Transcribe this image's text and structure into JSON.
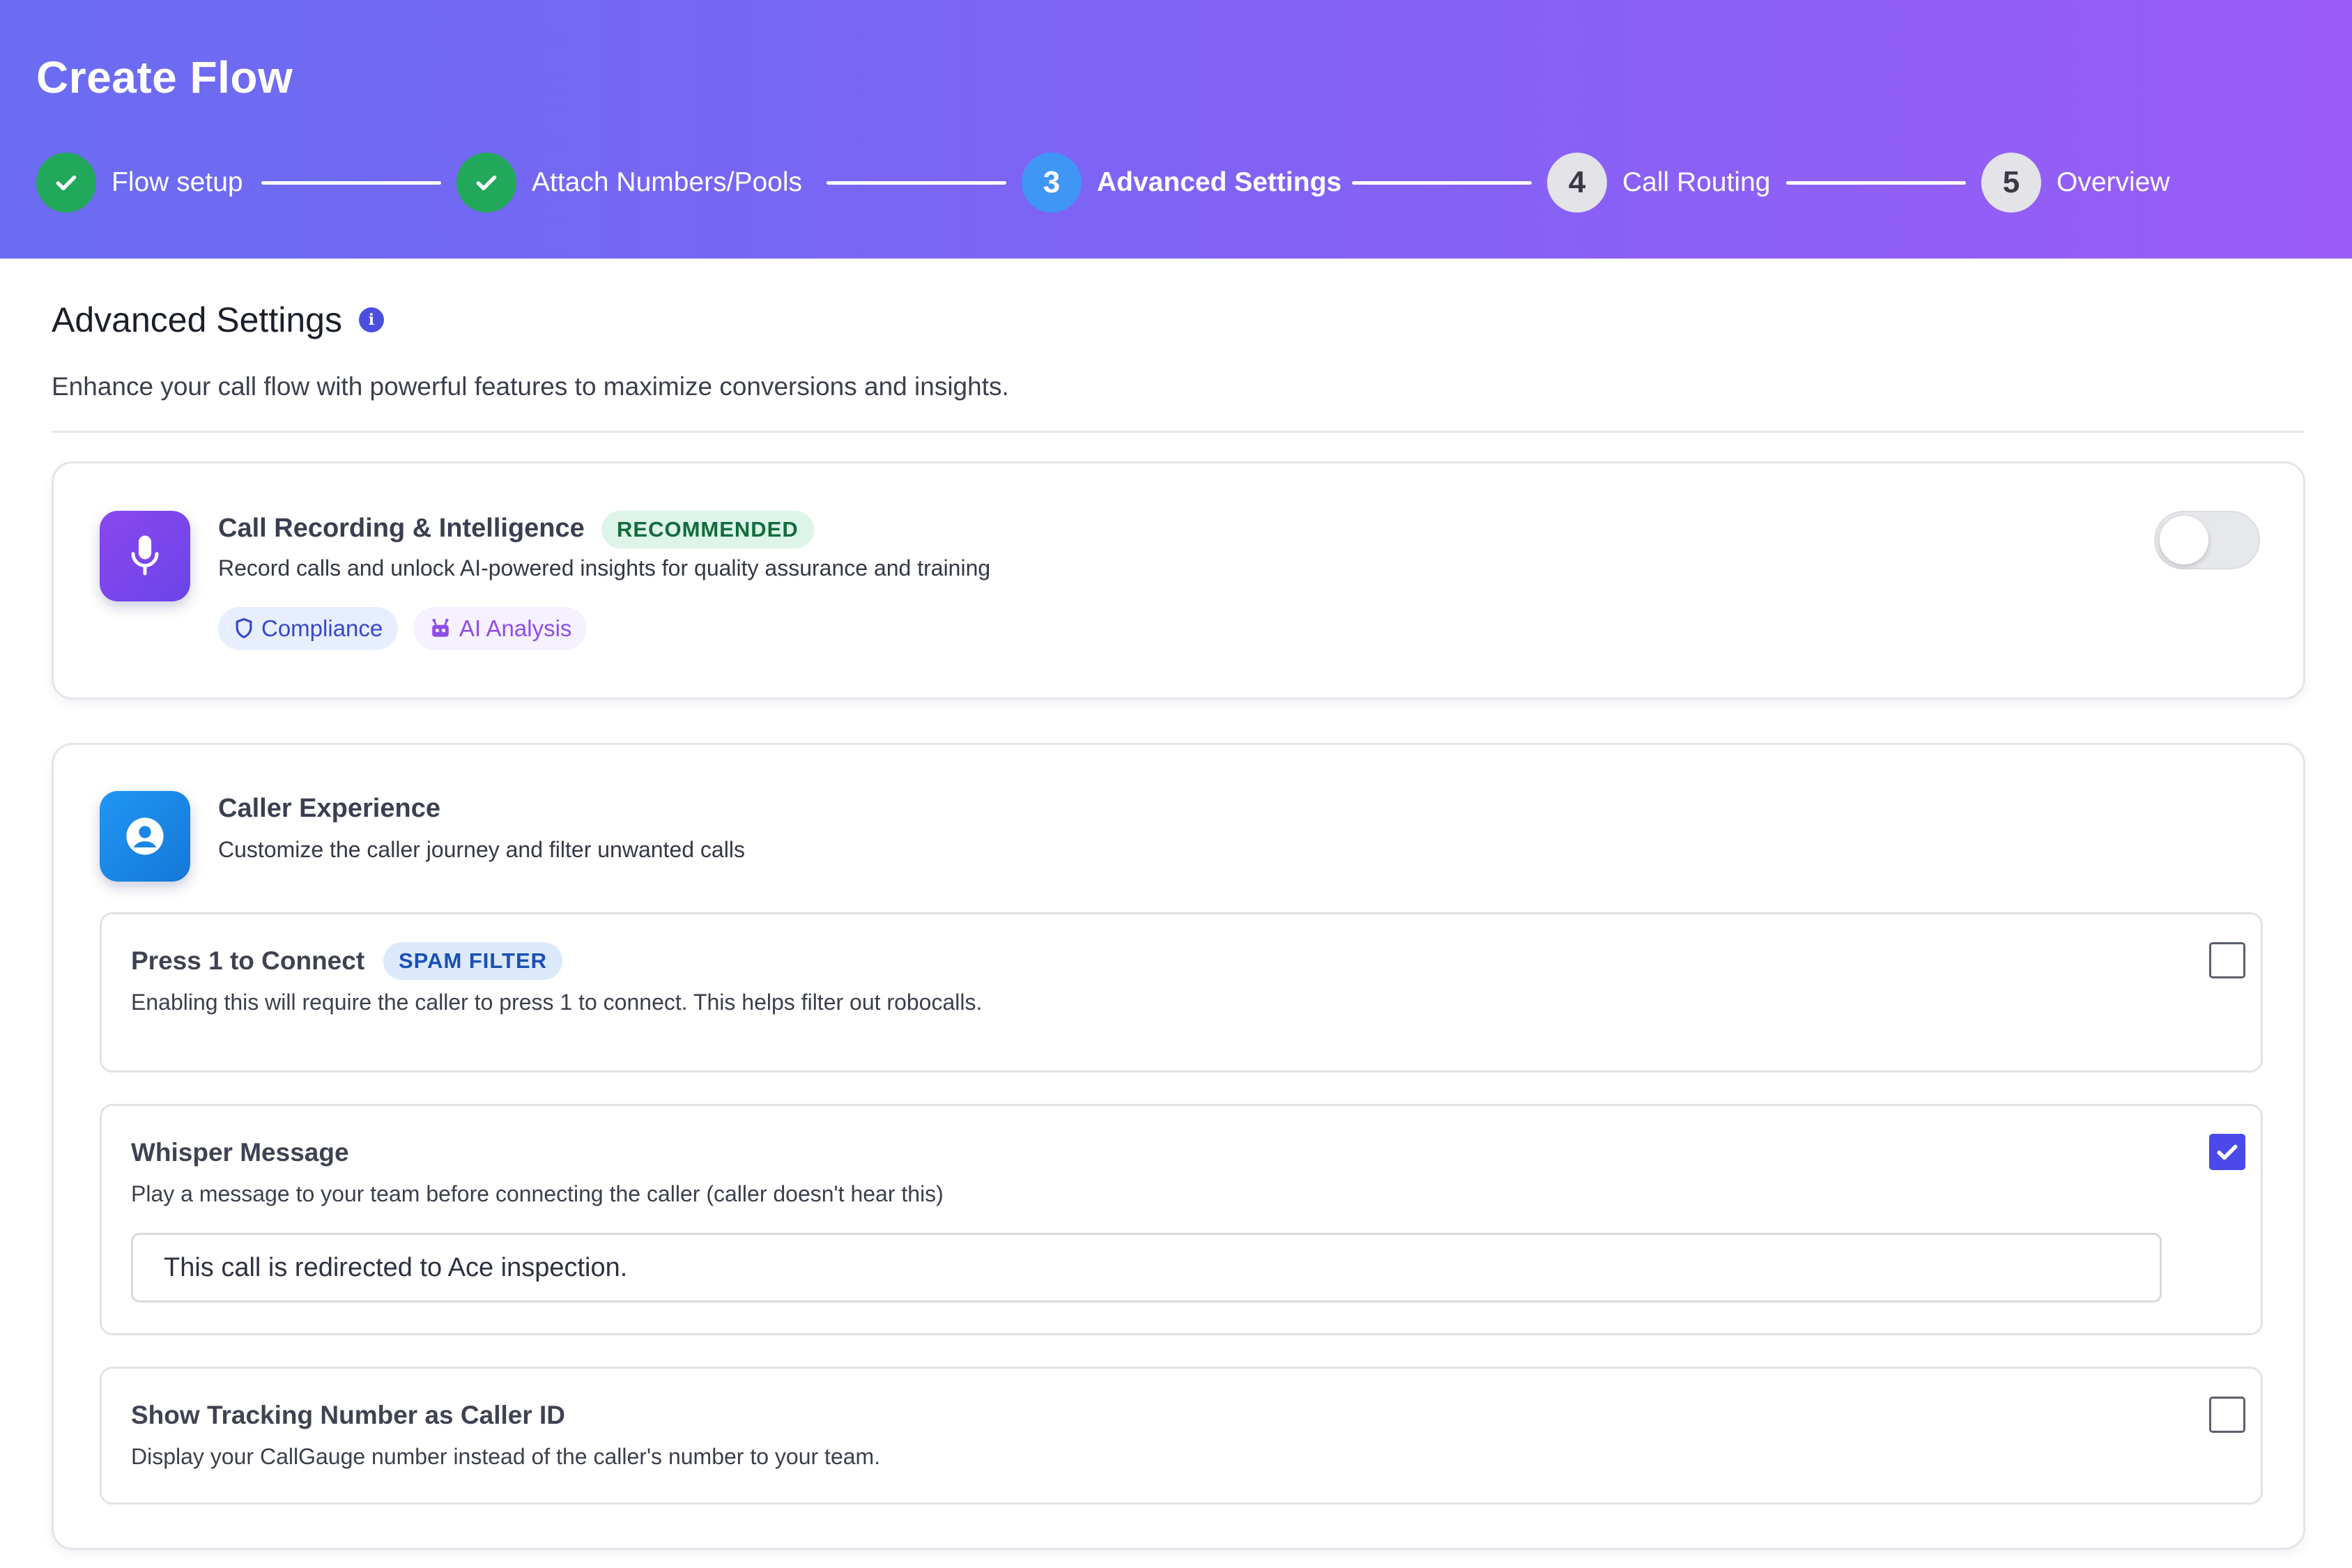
{
  "app": {
    "title": "Create Flow"
  },
  "stepper": {
    "steps": [
      {
        "label": "Flow setup",
        "state": "done",
        "number": ""
      },
      {
        "label": "Attach Numbers/Pools",
        "state": "done",
        "number": ""
      },
      {
        "label": "Advanced Settings",
        "state": "current",
        "number": "3"
      },
      {
        "label": "Call Routing",
        "state": "todo",
        "number": "4"
      },
      {
        "label": "Overview",
        "state": "todo",
        "number": "5"
      }
    ]
  },
  "section": {
    "title": "Advanced Settings",
    "info_icon": "i",
    "description": "Enhance your call flow with powerful features to maximize conversions and insights."
  },
  "recording_card": {
    "icon": "microphone-icon",
    "title": "Call Recording & Intelligence",
    "badge": "RECOMMENDED",
    "subtitle": "Record calls and unlock AI-powered insights for quality assurance and training",
    "chips": [
      {
        "label": "Compliance",
        "icon": "shield-icon"
      },
      {
        "label": "AI Analysis",
        "icon": "robot-icon"
      }
    ],
    "enabled": false
  },
  "caller_card": {
    "icon": "user-circle-icon",
    "title": "Caller Experience",
    "subtitle": "Customize the caller journey and filter unwanted calls",
    "options": [
      {
        "title": "Press 1 to Connect",
        "badge": "SPAM FILTER",
        "description": "Enabling this will require the caller to press 1 to connect. This helps filter out robocalls.",
        "checked": false
      },
      {
        "title": "Whisper Message",
        "description": "Play a message to your team before connecting the caller (caller doesn't hear this)",
        "checked": true,
        "input_value": "This call is redirected to Ace inspection."
      },
      {
        "title": "Show Tracking Number as Caller ID",
        "description": "Display your CallGauge number instead of the caller's number to your team.",
        "checked": false
      }
    ]
  },
  "colors": {
    "header_start": "#6a6cf2",
    "header_end": "#9a5cf7",
    "done": "#22a85a",
    "current": "#3f96f5",
    "accent": "#4b49e8",
    "recommended_bg": "#dcf5e8",
    "spam_bg": "#dbe9fb"
  }
}
